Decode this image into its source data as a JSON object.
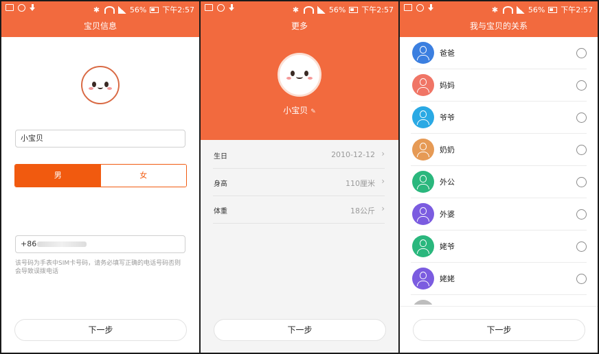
{
  "status_bar": {
    "battery": "56%",
    "time": "下午2:57"
  },
  "screen1": {
    "title": "宝贝信息",
    "name_value": "小宝贝",
    "gender": {
      "male": "男",
      "female": "女",
      "selected": "男"
    },
    "phone_prefix": "+86",
    "hint": "该号码为手表中SIM卡号码，请务必填写正确的电话号码否则会导致误拨电话",
    "next": "下一步"
  },
  "screen2": {
    "title": "更多",
    "nickname": "小宝贝",
    "rows": [
      {
        "key": "生日",
        "value": "2010-12-12"
      },
      {
        "key": "身高",
        "value": "110厘米"
      },
      {
        "key": "体重",
        "value": "18公斤"
      }
    ],
    "next": "下一步"
  },
  "screen3": {
    "title": "我与宝贝的关系",
    "relations": [
      {
        "name": "爸爸",
        "color": "#3b7fe0"
      },
      {
        "name": "妈妈",
        "color": "#f07566"
      },
      {
        "name": "爷爷",
        "color": "#2aa9e4"
      },
      {
        "name": "奶奶",
        "color": "#e69a55"
      },
      {
        "name": "外公",
        "color": "#2ab77d"
      },
      {
        "name": "外婆",
        "color": "#7b5ce0"
      },
      {
        "name": "姥爷",
        "color": "#2ab77d"
      },
      {
        "name": "姥姥",
        "color": "#7b5ce0"
      }
    ],
    "next": "下一步"
  },
  "colors": {
    "accent": "#f26a3e",
    "selected_gender": "#f15a0f"
  },
  "icons": {
    "status_left": [
      "image-icon",
      "gauge-icon",
      "download-icon"
    ],
    "status_right": [
      "bluetooth-icon",
      "wifi-icon",
      "signal-icon",
      "battery-icon"
    ],
    "edit": "pencil-icon",
    "chevron": "chevron-right-icon"
  }
}
